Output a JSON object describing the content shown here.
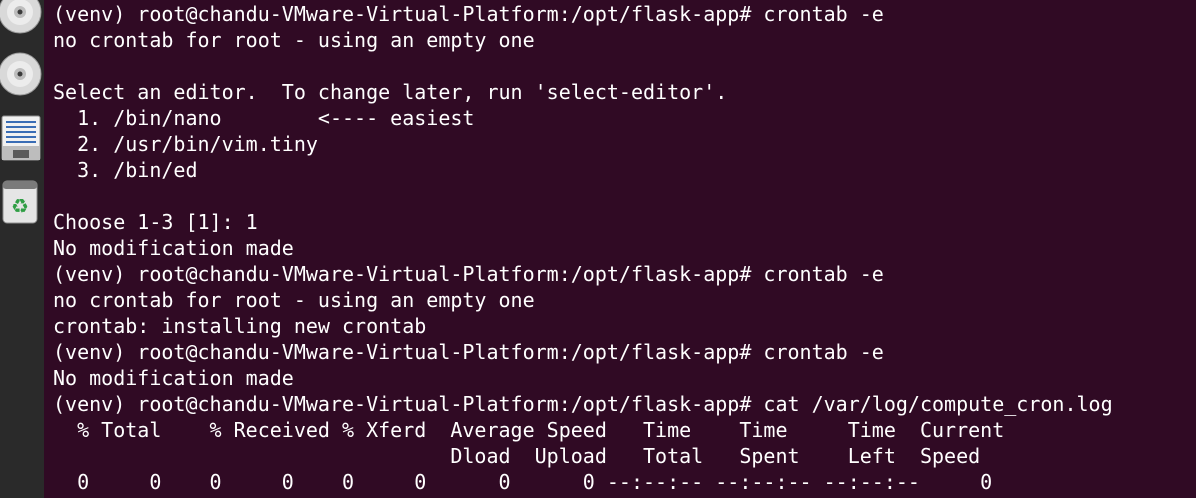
{
  "dock": {
    "items": [
      {
        "name": "disc-drive-icon"
      },
      {
        "name": "disc-drive-icon"
      },
      {
        "name": "text-document-icon"
      },
      {
        "name": "trash-icon"
      }
    ]
  },
  "terminal": {
    "lines": [
      "(venv) root@chandu-VMware-Virtual-Platform:/opt/flask-app# crontab -e",
      "no crontab for root - using an empty one",
      "",
      "Select an editor.  To change later, run 'select-editor'.",
      "  1. /bin/nano        <---- easiest",
      "  2. /usr/bin/vim.tiny",
      "  3. /bin/ed",
      "",
      "Choose 1-3 [1]: 1",
      "No modification made",
      "(venv) root@chandu-VMware-Virtual-Platform:/opt/flask-app# crontab -e",
      "no crontab for root - using an empty one",
      "crontab: installing new crontab",
      "(venv) root@chandu-VMware-Virtual-Platform:/opt/flask-app# crontab -e",
      "No modification made",
      "(venv) root@chandu-VMware-Virtual-Platform:/opt/flask-app# cat /var/log/compute_cron.log",
      "  % Total    % Received % Xferd  Average Speed   Time    Time     Time  Current",
      "                                 Dload  Upload   Total   Spent    Left  Speed",
      "  0     0    0     0    0     0      0      0 --:--:-- --:--:-- --:--:--     0"
    ]
  }
}
